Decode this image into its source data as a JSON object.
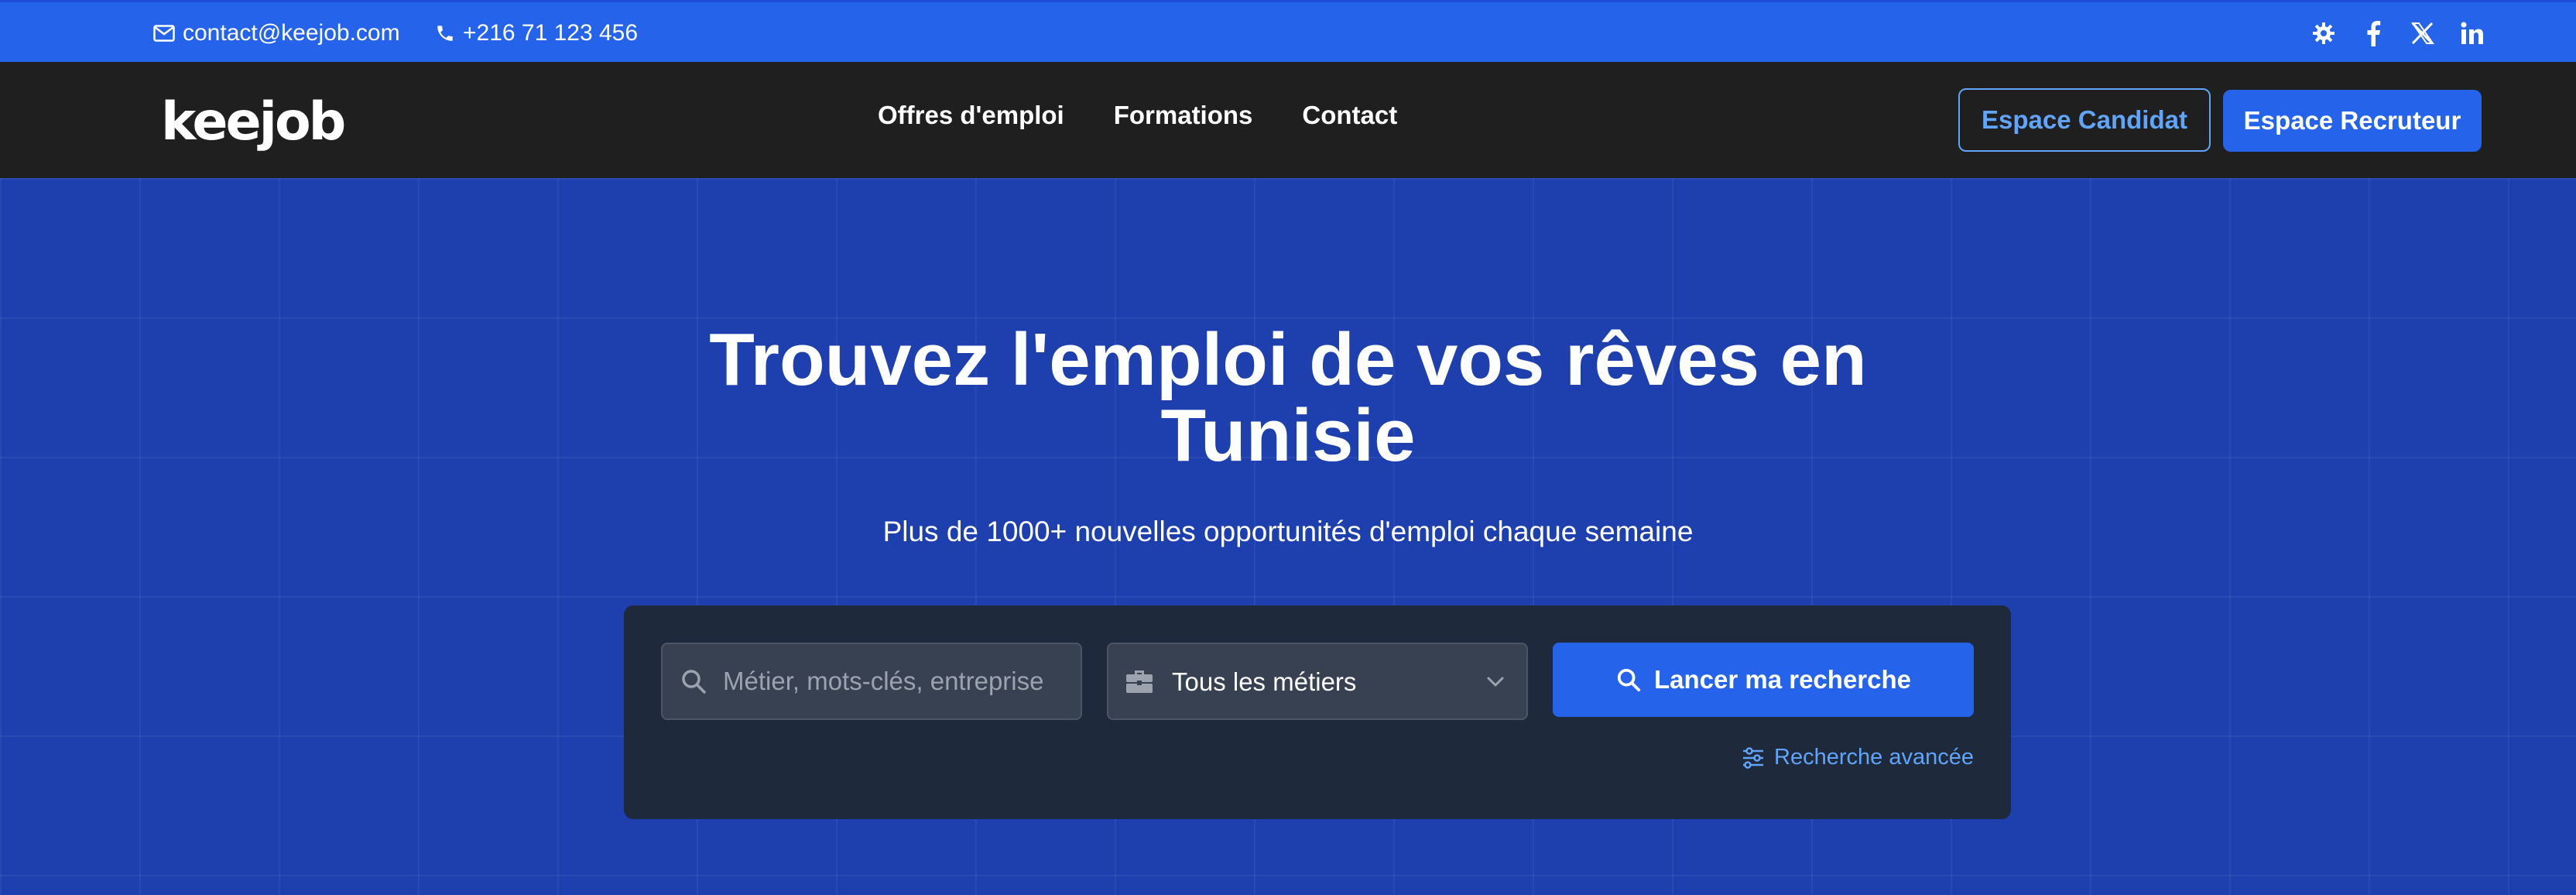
{
  "topbar": {
    "email": "contact@keejob.com",
    "phone": "+216 71 123 456",
    "socials": [
      {
        "icon": "theme-gear-icon"
      },
      {
        "icon": "facebook-icon"
      },
      {
        "icon": "x-twitter-icon"
      },
      {
        "icon": "linkedin-icon"
      }
    ]
  },
  "navbar": {
    "logo": "keejob",
    "links": [
      "Offres d'emploi",
      "Formations",
      "Contact"
    ],
    "candidate_button": "Espace Candidat",
    "recruiter_button": "Espace Recruteur"
  },
  "hero": {
    "title_line1": "Trouvez l'emploi de vos rêves en",
    "title_line2": "Tunisie",
    "subtitle": "Plus de 1000+ nouvelles opportunités d'emploi chaque semaine"
  },
  "search": {
    "keyword_placeholder": "Métier, mots-clés, entreprise",
    "keyword_value": "",
    "category_selected": "Tous les métiers",
    "submit_label": "Lancer ma recherche",
    "advanced_label": "Recherche avancée"
  },
  "colors": {
    "topbar": "#2563eb",
    "navbar": "#1f1f1f",
    "hero": "#1e40af",
    "accent": "#2563eb",
    "link": "#60a5fa",
    "panel": "#1e293b"
  }
}
